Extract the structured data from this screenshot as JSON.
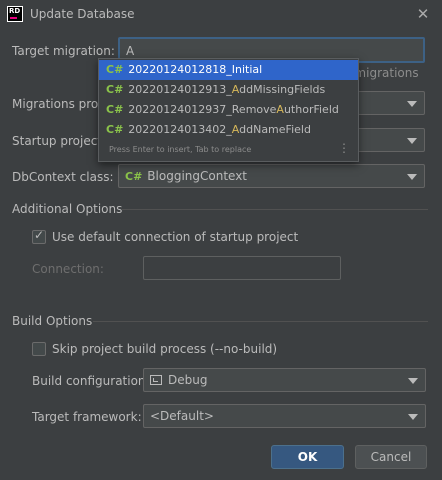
{
  "window": {
    "title": "Update Database",
    "logo_text": "RD"
  },
  "fields": {
    "target_migration": {
      "label": "Target migration:",
      "value": "A",
      "hint_suffix": "d migrations"
    },
    "migrations_project": {
      "label": "Migrations proje"
    },
    "startup_project": {
      "label": "Startup project:"
    },
    "dbcontext": {
      "label": "DbContext class:",
      "prefix": "C#",
      "value": "BloggingContext"
    }
  },
  "autocomplete": {
    "items": [
      {
        "prefix": "C#",
        "text_pre": "20220124012818_",
        "match": "",
        "text_post": "Initial"
      },
      {
        "prefix": "C#",
        "text_pre": "20220124012913_",
        "match": "A",
        "text_post": "ddMissingFields"
      },
      {
        "prefix": "C#",
        "text_pre": "20220124012937_Remove",
        "match": "A",
        "text_post": "uthorField"
      },
      {
        "prefix": "C#",
        "text_pre": "20220124013402_",
        "match": "A",
        "text_post": "ddNameField"
      }
    ],
    "hint": "Press Enter to insert, Tab to replace",
    "more_icon": "⋮"
  },
  "additional_options": {
    "title": "Additional Options",
    "use_default_connection": {
      "label": "Use default connection of startup project",
      "checked": true
    },
    "connection_label": "Connection:"
  },
  "build_options": {
    "title": "Build Options",
    "skip_build": {
      "label": "Skip project build process (--no-build)",
      "checked": false
    },
    "build_configuration": {
      "label": "Build configuration:",
      "value": "Debug"
    },
    "target_framework": {
      "label": "Target framework:",
      "value": "<Default>"
    }
  },
  "buttons": {
    "ok": "OK",
    "cancel": "Cancel"
  }
}
